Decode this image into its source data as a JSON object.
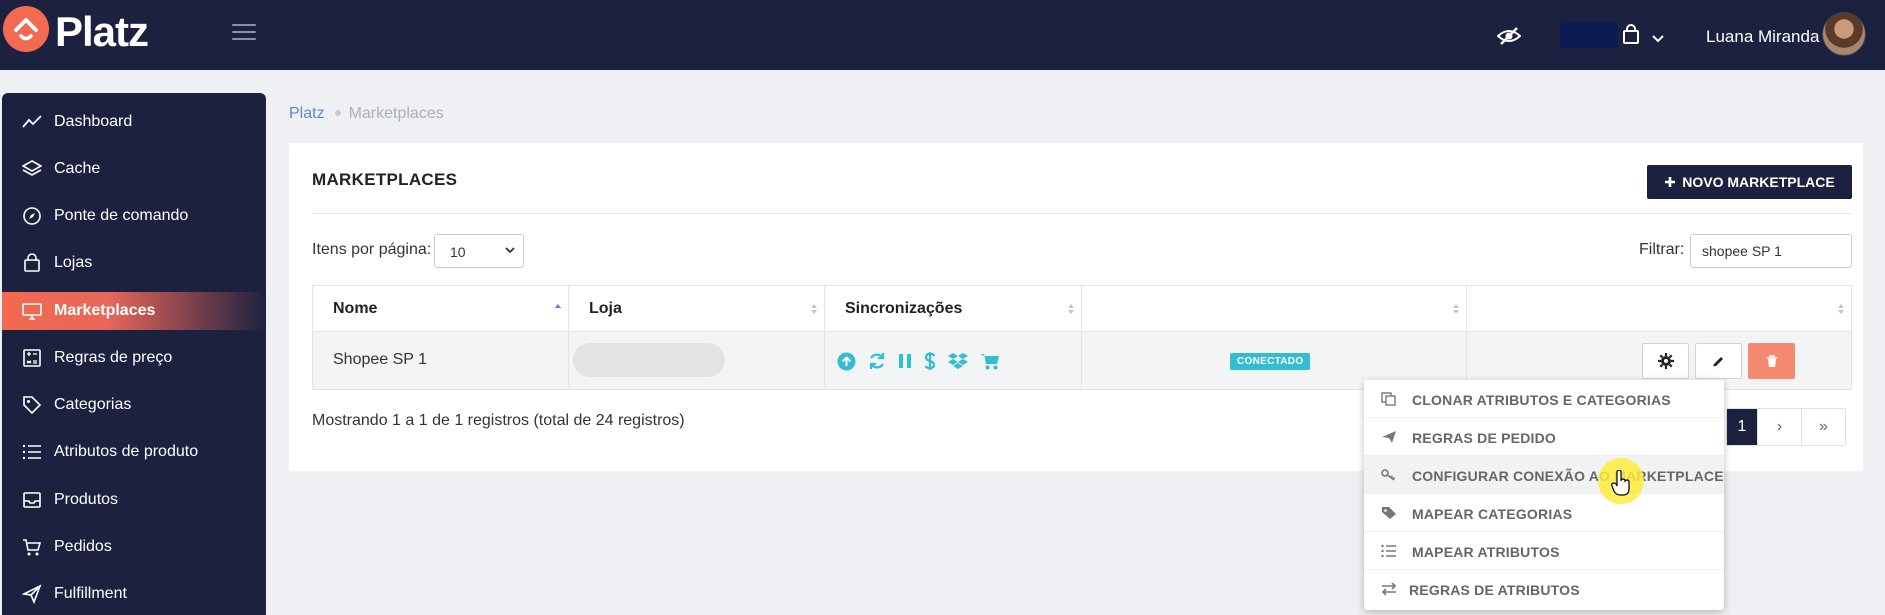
{
  "app": {
    "brand": "Platz",
    "brand_color": "#f26a4f",
    "nav_color": "#1d2140"
  },
  "topbar": {
    "user_name": "Luana Miranda",
    "icons": [
      "hide-eye-icon",
      "shopping-bag-icon",
      "chevron-down-icon"
    ]
  },
  "sidebar": {
    "items": [
      {
        "label": "Dashboard",
        "icon": "chart-line-icon"
      },
      {
        "label": "Cache",
        "icon": "layers-icon"
      },
      {
        "label": "Ponte de comando",
        "icon": "compass-icon"
      },
      {
        "label": "Lojas",
        "icon": "shopping-bag-icon"
      },
      {
        "label": "Marketplaces",
        "icon": "monitor-icon",
        "active": true
      },
      {
        "label": "Regras de preço",
        "icon": "calculator-icon"
      },
      {
        "label": "Categorias",
        "icon": "tag-icon"
      },
      {
        "label": "Atributos de produto",
        "icon": "list-icon"
      },
      {
        "label": "Produtos",
        "icon": "inbox-icon"
      },
      {
        "label": "Pedidos",
        "icon": "cart-icon"
      },
      {
        "label": "Fulfillment",
        "icon": "send-icon"
      }
    ]
  },
  "breadcrumb": {
    "root": "Platz",
    "current": "Marketplaces"
  },
  "card": {
    "title": "MARKETPLACES",
    "new_button": "NOVO MARKETPLACE",
    "per_page_label": "Itens por página:",
    "per_page_value": "10",
    "filter_label": "Filtrar:",
    "filter_value": "shopee SP 1"
  },
  "table": {
    "columns": [
      "Nome",
      "Loja",
      "Sincronizações",
      "",
      ""
    ],
    "rows": [
      {
        "nome": "Shopee SP 1",
        "loja": "",
        "sync_icons": [
          "upload-icon",
          "refresh-icon",
          "pause-icon",
          "dollar-icon",
          "dropbox-icon",
          "cart-icon"
        ],
        "status": "CONECTADO",
        "status_color": "#32bdd0"
      }
    ]
  },
  "footer": {
    "showing": "Mostrando 1 a 1 de 1 registros (total de 24 registros)",
    "pages": [
      "1",
      "›",
      "»"
    ]
  },
  "menu": {
    "items": [
      {
        "label": "CLONAR ATRIBUTOS E CATEGORIAS",
        "icon": "copy-icon"
      },
      {
        "label": "REGRAS DE PEDIDO",
        "icon": "paper-plane-icon"
      },
      {
        "label": "CONFIGURAR CONEXÃO AO MARKETPLACE",
        "icon": "key-icon",
        "hovered": true
      },
      {
        "label": "MAPEAR CATEGORIAS",
        "icon": "tag-icon"
      },
      {
        "label": "MAPEAR ATRIBUTOS",
        "icon": "list-icon"
      },
      {
        "label": "REGRAS DE ATRIBUTOS",
        "icon": "exchange-icon"
      }
    ]
  }
}
